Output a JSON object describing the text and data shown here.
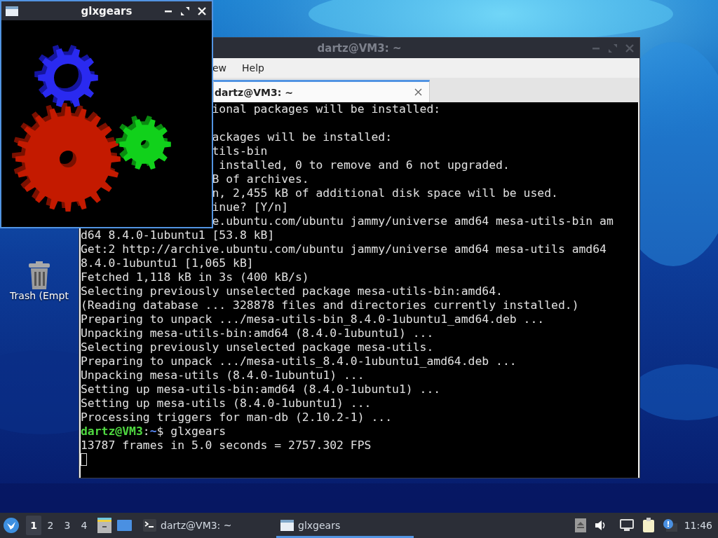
{
  "desktop": {
    "icons": [
      {
        "label": "Trash (Empt"
      }
    ]
  },
  "terminal_window": {
    "title": "dartz@VM3: ~",
    "active": false,
    "menu": [
      "ew",
      "Help"
    ],
    "tabs": [
      {
        "label": "dartz@VM3: ~",
        "selected": true
      }
    ],
    "lines": [
      {
        "kind": "text",
        "covered": true,
        "text": "ional packages will be installed:"
      },
      {
        "kind": "blank"
      },
      {
        "kind": "text",
        "covered": true,
        "text": "ackages will be installed:"
      },
      {
        "kind": "text",
        "covered": true,
        "text": "tils-bin"
      },
      {
        "kind": "text",
        "covered": true,
        "text": " installed, 0 to remove and 6 not upgraded."
      },
      {
        "kind": "text",
        "covered": true,
        "text": "B of archives."
      },
      {
        "kind": "text",
        "covered": true,
        "text": "n, 2,455 kB of additional disk space will be used."
      },
      {
        "kind": "text",
        "covered": true,
        "text": "inue? [Y/n]"
      },
      {
        "kind": "text",
        "covered": true,
        "text": "e.ubuntu.com/ubuntu jammy/universe amd64 mesa-utils-bin am"
      },
      {
        "kind": "text",
        "covered": false,
        "text": "d64 8.4.0-1ubuntu1 [53.8 kB]"
      },
      {
        "kind": "text",
        "covered": false,
        "text": "Get:2 http://archive.ubuntu.com/ubuntu jammy/universe amd64 mesa-utils amd64"
      },
      {
        "kind": "text",
        "covered": false,
        "text": "8.4.0-1ubuntu1 [1,065 kB]"
      },
      {
        "kind": "text",
        "covered": false,
        "text": "Fetched 1,118 kB in 3s (400 kB/s)"
      },
      {
        "kind": "text",
        "covered": false,
        "text": "Selecting previously unselected package mesa-utils-bin:amd64."
      },
      {
        "kind": "text",
        "covered": false,
        "text": "(Reading database ... 328878 files and directories currently installed.)"
      },
      {
        "kind": "text",
        "covered": false,
        "text": "Preparing to unpack .../mesa-utils-bin_8.4.0-1ubuntu1_amd64.deb ..."
      },
      {
        "kind": "text",
        "covered": false,
        "text": "Unpacking mesa-utils-bin:amd64 (8.4.0-1ubuntu1) ..."
      },
      {
        "kind": "text",
        "covered": false,
        "text": "Selecting previously unselected package mesa-utils."
      },
      {
        "kind": "text",
        "covered": false,
        "text": "Preparing to unpack .../mesa-utils_8.4.0-1ubuntu1_amd64.deb ..."
      },
      {
        "kind": "text",
        "covered": false,
        "text": "Unpacking mesa-utils (8.4.0-1ubuntu1) ..."
      },
      {
        "kind": "text",
        "covered": false,
        "text": "Setting up mesa-utils-bin:amd64 (8.4.0-1ubuntu1) ..."
      },
      {
        "kind": "text",
        "covered": false,
        "text": "Setting up mesa-utils (8.4.0-1ubuntu1) ..."
      },
      {
        "kind": "text",
        "covered": false,
        "text": "Processing triggers for man-db (2.10.2-1) ..."
      },
      {
        "kind": "prompt",
        "user_host": "dartz@VM3",
        "separator": ":",
        "path": "~",
        "command": "$ glxgears"
      },
      {
        "kind": "text",
        "covered": false,
        "text": "13787 frames in 5.0 seconds = 2757.302 FPS"
      },
      {
        "kind": "cursor"
      }
    ]
  },
  "glxgears_window": {
    "title": "glxgears",
    "active": true
  },
  "taskbar": {
    "workspaces": [
      {
        "label": "1",
        "selected": true
      },
      {
        "label": "2",
        "selected": false
      },
      {
        "label": "3",
        "selected": false
      },
      {
        "label": "4",
        "selected": false
      }
    ],
    "tasks": [
      {
        "label": "dartz@VM3: ~",
        "kind": "terminal",
        "selected": false
      },
      {
        "label": "glxgears",
        "kind": "window",
        "selected": true
      }
    ],
    "clock": "11:46"
  }
}
